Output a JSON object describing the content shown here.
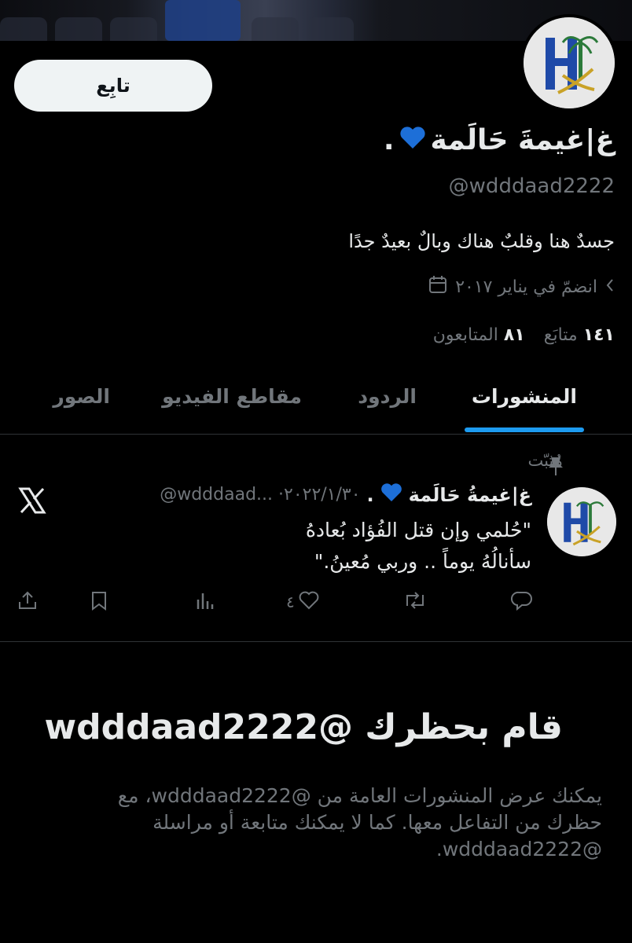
{
  "profile": {
    "follow_label": "تابِع",
    "display_name": "غ|غيمةَ حَالَمة",
    "name_suffix": ".",
    "heart_icon": "blue-heart-icon",
    "handle": "@wdddaad2222",
    "bio": "جسدٌ هنا وقلبٌ هناك وبالٌ بعيدٌ جدًا",
    "joined": "انضمّ في يناير ٢٠١٧",
    "following_count": "١٤١",
    "following_label": "متابَع",
    "followers_count": "٨١",
    "followers_label": "المتابعون"
  },
  "tabs": [
    {
      "label": "المنشورات",
      "active": true
    },
    {
      "label": "الردود",
      "active": false
    },
    {
      "label": "مقاطع الفيديو",
      "active": false
    },
    {
      "label": "الصور",
      "active": false
    }
  ],
  "pinned_post": {
    "pinned_label": "مُثبّت",
    "author_name": "غ|غيمةُ حَالَمة",
    "author_suffix": ".",
    "meta": "@wdddaad... ·٢٠٢٢/١/٣٠",
    "line1": "\"حُلمي وإن قتل الفُؤاد بُعادهُ",
    "line2": "سأنالُهُ يوماً .. وربي مُعينُ.\"",
    "likes": "٤",
    "icons": [
      "reply-icon",
      "repost-icon",
      "like-icon",
      "views-icon",
      "bookmark-icon",
      "share-icon"
    ]
  },
  "blocked": {
    "title": "قام بحظرك @wdddaad2222",
    "body": "يمكنك عرض المنشورات العامة من @wdddaad2222، مع حظرك من التفاعل معها. كما لا يمكنك متابعة أو مراسلة @wdddaad2222."
  },
  "colors": {
    "accent": "#1d9bf0",
    "heart": "#1d6fd8",
    "logo_blue": "#1f4aa8"
  }
}
